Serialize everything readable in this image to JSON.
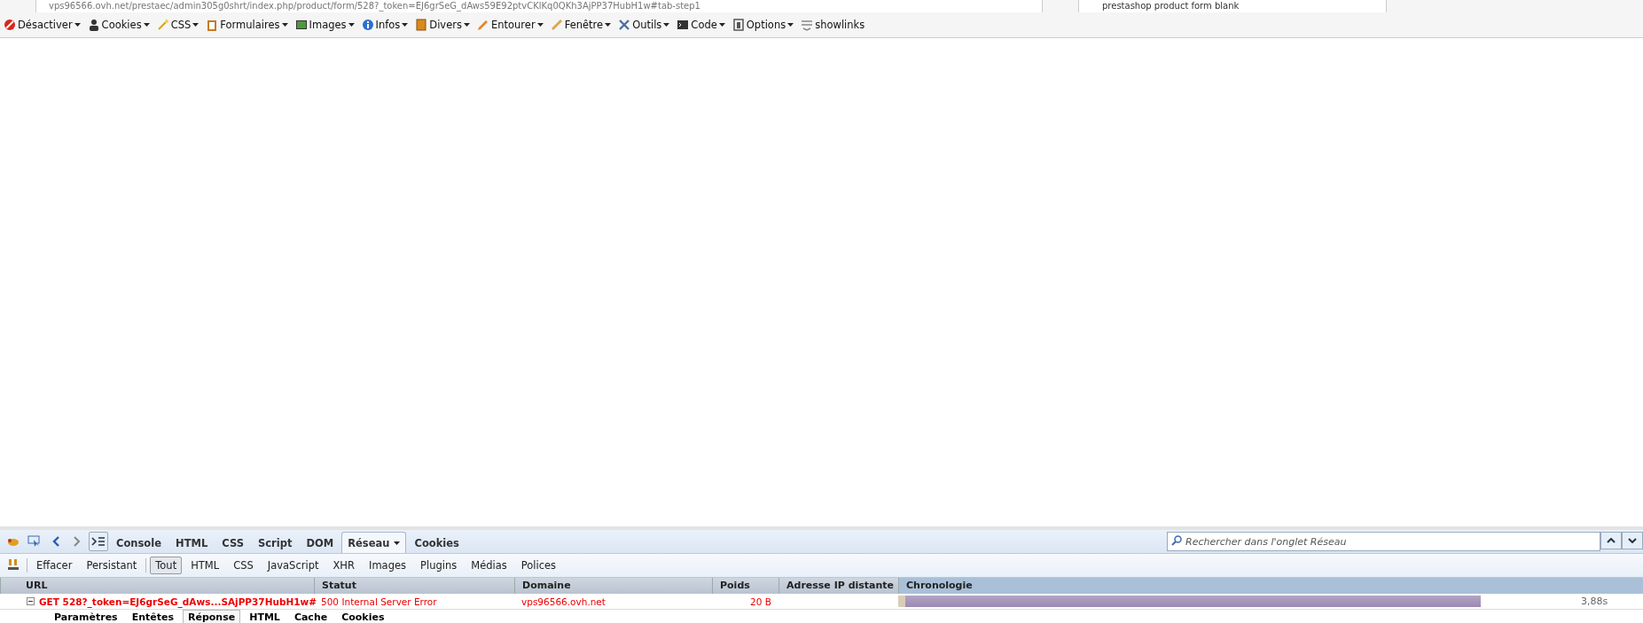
{
  "address_bar": {
    "url": "vps96566.ovh.net/prestaec/admin305g0shrt/index.php/product/form/528?_token=EJ6grSeG_dAws59E92ptvCKlKq0QKh3AjPP37HubH1w#tab-step1",
    "search": "prestashop product form blank"
  },
  "dev_toolbar": [
    {
      "label": "Désactiver",
      "menu": true
    },
    {
      "label": "Cookies",
      "menu": true
    },
    {
      "label": "CSS",
      "menu": true
    },
    {
      "label": "Formulaires",
      "menu": true
    },
    {
      "label": "Images",
      "menu": true
    },
    {
      "label": "Infos",
      "menu": true
    },
    {
      "label": "Divers",
      "menu": true
    },
    {
      "label": "Entourer",
      "menu": true
    },
    {
      "label": "Fenêtre",
      "menu": true
    },
    {
      "label": "Outils",
      "menu": true
    },
    {
      "label": "Code",
      "menu": true
    },
    {
      "label": "Options",
      "menu": true
    },
    {
      "label": "showlinks",
      "menu": false
    }
  ],
  "panel_tabs": [
    {
      "label": "Console",
      "selected": false,
      "menu": false
    },
    {
      "label": "HTML",
      "selected": false,
      "menu": false
    },
    {
      "label": "CSS",
      "selected": false,
      "menu": false
    },
    {
      "label": "Script",
      "selected": false,
      "menu": false
    },
    {
      "label": "DOM",
      "selected": false,
      "menu": false
    },
    {
      "label": "Réseau",
      "selected": true,
      "menu": true
    },
    {
      "label": "Cookies",
      "selected": false,
      "menu": false
    }
  ],
  "panel_search": {
    "placeholder": "Rechercher dans l'onglet Réseau"
  },
  "actions": [
    "Effacer",
    "Persistant"
  ],
  "filters": [
    {
      "label": "Tout",
      "selected": true
    },
    {
      "label": "HTML",
      "selected": false
    },
    {
      "label": "CSS",
      "selected": false
    },
    {
      "label": "JavaScript",
      "selected": false
    },
    {
      "label": "XHR",
      "selected": false
    },
    {
      "label": "Images",
      "selected": false
    },
    {
      "label": "Plugins",
      "selected": false
    },
    {
      "label": "Médias",
      "selected": false
    },
    {
      "label": "Polices",
      "selected": false
    }
  ],
  "table": {
    "columns": [
      "URL",
      "Statut",
      "Domaine",
      "Poids",
      "Adresse IP distante",
      "Chronologie"
    ],
    "rows": [
      {
        "expanded": true,
        "error": true,
        "url": "GET 528?_token=EJ6grSeG_dAws...SAjPP37HubH1w#",
        "status": "500 Internal Server Error",
        "domain": "vps96566.ovh.net",
        "size": "20 B",
        "level": 0.86,
        "time": "3,88s"
      }
    ]
  },
  "detail_tabs": [
    {
      "label": "Paramètres",
      "selected": false
    },
    {
      "label": "Entêtes",
      "selected": false
    },
    {
      "label": "Réponse",
      "selected": true
    },
    {
      "label": "HTML",
      "selected": false
    },
    {
      "label": "Cache",
      "selected": false
    },
    {
      "label": "Cookies",
      "selected": false
    }
  ]
}
